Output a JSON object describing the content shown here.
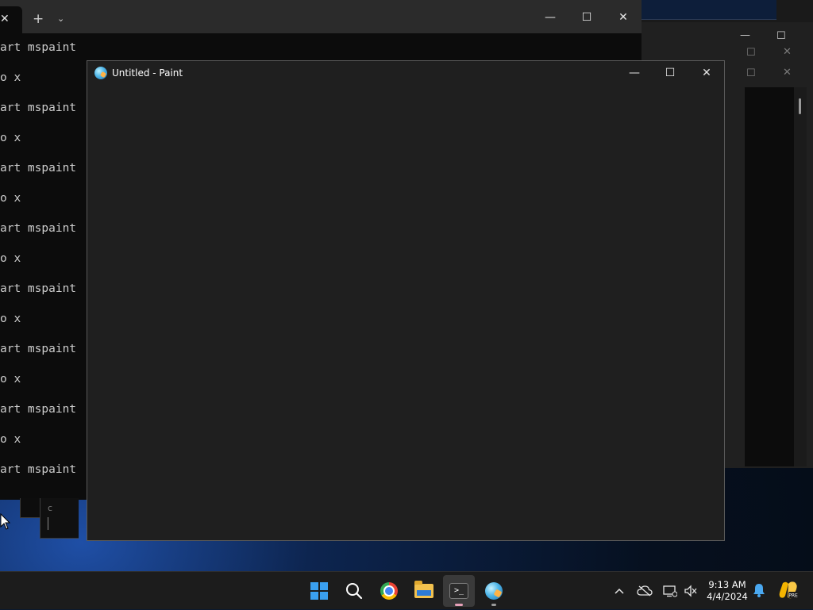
{
  "terminal": {
    "tab_close": "✕",
    "new_tab": "+",
    "dropdown": "⌄",
    "window_min": "—",
    "window_max": "☐",
    "window_close": "✕",
    "lines": [
      "art mspaint",
      "o x",
      "art mspaint",
      "o x",
      "art mspaint",
      "o x",
      "art mspaint",
      "o x",
      "art mspaint",
      "o x",
      "art mspaint",
      "o x",
      "art mspaint",
      "o x",
      "art mspaint"
    ]
  },
  "paint": {
    "title": "Untitled - Paint",
    "window_min": "—",
    "window_max": "☐",
    "window_close": "✕"
  },
  "bg_window": {
    "min": "—",
    "max": "☐",
    "close": "✕"
  },
  "taskbar": {
    "items": [
      {
        "name": "start-button",
        "icon": "windows-logo-icon"
      },
      {
        "name": "search-button",
        "icon": "search-icon"
      },
      {
        "name": "chrome",
        "icon": "chrome-icon"
      },
      {
        "name": "file-explorer",
        "icon": "folder-icon"
      },
      {
        "name": "terminal",
        "icon": "terminal-icon",
        "active": true
      },
      {
        "name": "paint",
        "icon": "paint-icon"
      }
    ],
    "tray": {
      "overflow": "^",
      "time": "9:13 AM",
      "date": "4/4/2024"
    }
  },
  "colors": {
    "accent": "#3aa0f0",
    "terminal_bg": "#0c0c0c",
    "paint_bg": "#1f1f1f",
    "taskbar_bg": "#1c1c1c"
  }
}
